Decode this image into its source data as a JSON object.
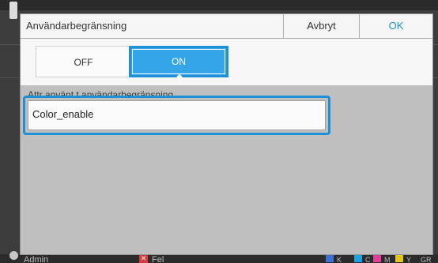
{
  "dialog": {
    "title": "Användarbegränsning",
    "cancel_label": "Avbryt",
    "ok_label": "OK"
  },
  "toggle": {
    "off_label": "OFF",
    "on_label": "ON",
    "selected": "ON"
  },
  "section_label": "Attr använt t användarbegränsning",
  "field": {
    "value": "Color_enable"
  },
  "status_bar": {
    "user": "Admin",
    "error_badge": "✕",
    "error_label": "Fel",
    "ink_labels": [
      "K",
      "C",
      "M",
      "Y",
      "GR"
    ]
  },
  "colors": {
    "accent": "#34a6e8",
    "ok_text": "#1e8fcf",
    "dialog_body": "#bfbfbf"
  }
}
